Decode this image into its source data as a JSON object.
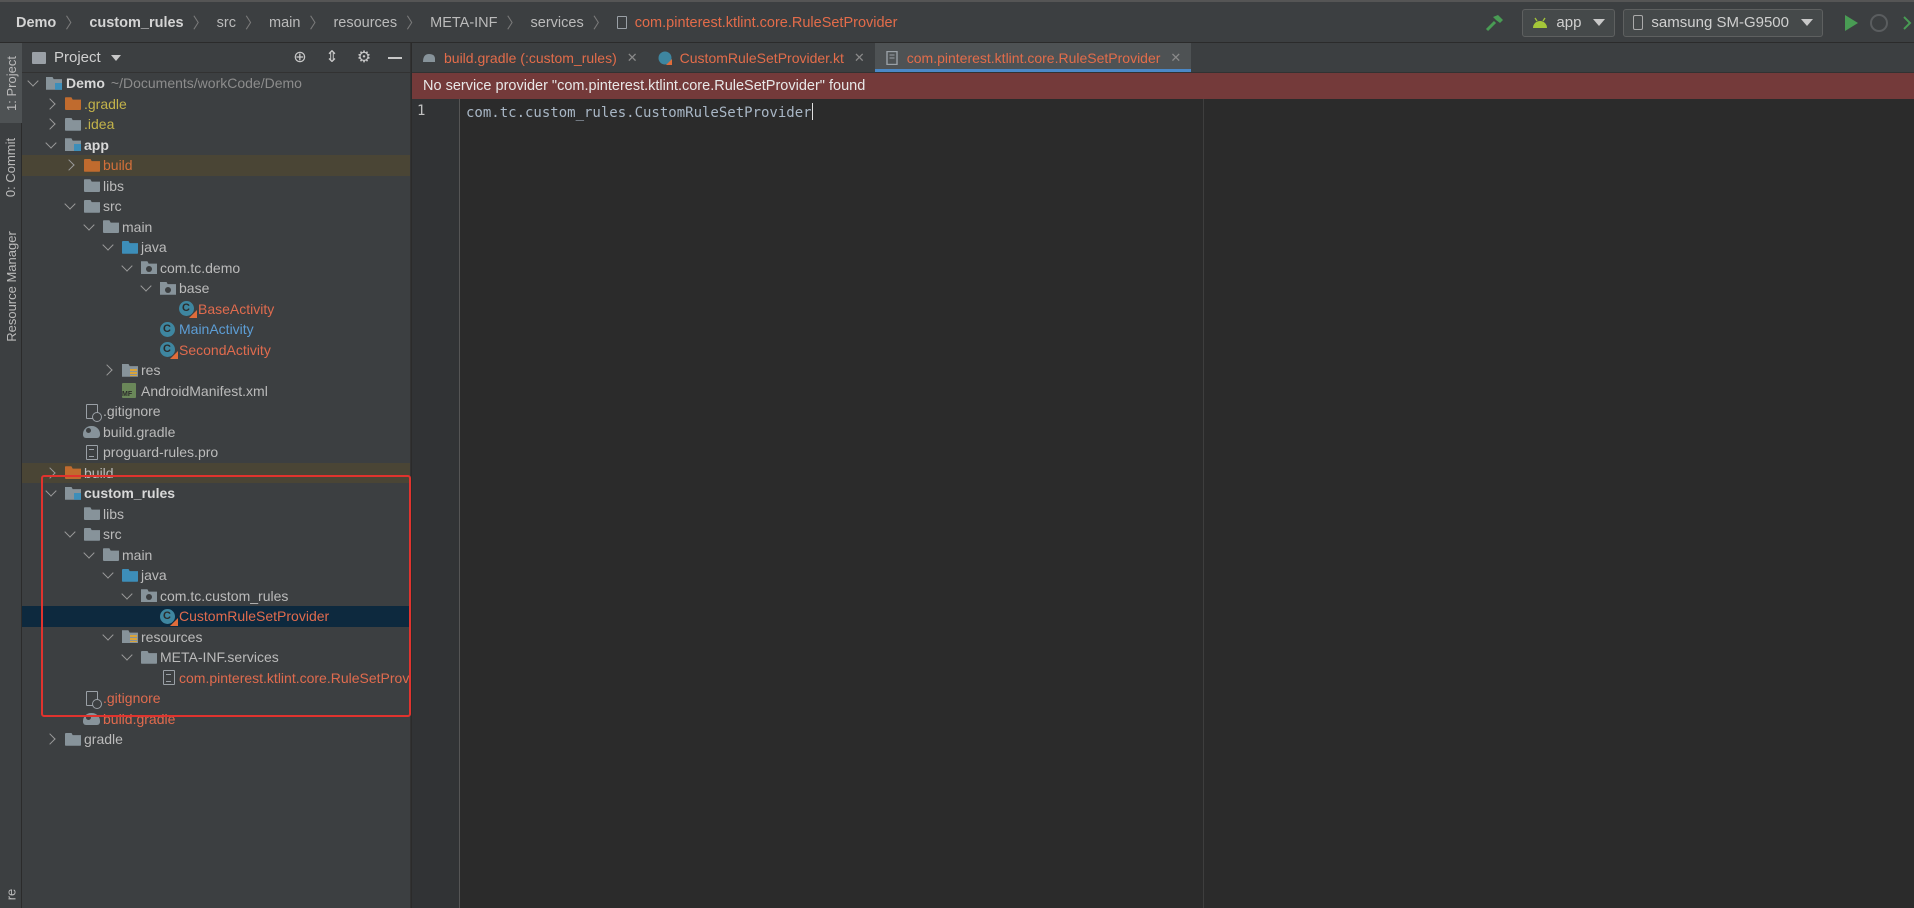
{
  "breadcrumbs": [
    "Demo",
    "custom_rules",
    "src",
    "main",
    "resources",
    "META-INF",
    "services",
    "com.pinterest.ktlint.core.RuleSetProvider"
  ],
  "toolbar": {
    "run_config": "app",
    "device": "samsung SM-G9500"
  },
  "left_strip": {
    "tabs": [
      "1: Project",
      "0: Commit",
      "Resource Manager",
      "re"
    ]
  },
  "project_panel": {
    "title": "Project",
    "tree": [
      {
        "label": "Demo",
        "path": "~/Documents/workCode/Demo"
      },
      {
        "label": ".gradle"
      },
      {
        "label": ".idea"
      },
      {
        "label": "app"
      },
      {
        "label": "build"
      },
      {
        "label": "libs"
      },
      {
        "label": "src"
      },
      {
        "label": "main"
      },
      {
        "label": "java"
      },
      {
        "label": "com.tc.demo"
      },
      {
        "label": "base"
      },
      {
        "label": "BaseActivity"
      },
      {
        "label": "MainActivity"
      },
      {
        "label": "SecondActivity"
      },
      {
        "label": "res"
      },
      {
        "label": "AndroidManifest.xml"
      },
      {
        "label": ".gitignore"
      },
      {
        "label": "build.gradle"
      },
      {
        "label": "proguard-rules.pro"
      },
      {
        "label": "build"
      },
      {
        "label": "custom_rules"
      },
      {
        "label": "libs"
      },
      {
        "label": "src"
      },
      {
        "label": "main"
      },
      {
        "label": "java"
      },
      {
        "label": "com.tc.custom_rules"
      },
      {
        "label": "CustomRuleSetProvider"
      },
      {
        "label": "resources"
      },
      {
        "label": "META-INF.services"
      },
      {
        "label": "com.pinterest.ktlint.core.RuleSetProvider"
      },
      {
        "label": ".gitignore"
      },
      {
        "label": "build.gradle"
      },
      {
        "label": "gradle"
      }
    ]
  },
  "editor": {
    "tabs": [
      {
        "label": "build.gradle (:custom_rules)"
      },
      {
        "label": "CustomRuleSetProvider.kt"
      },
      {
        "label": "com.pinterest.ktlint.core.RuleSetProvider"
      }
    ],
    "banner": "No service provider \"com.pinterest.ktlint.core.RuleSetProvider\" found",
    "line_number": "1",
    "code": "com.tc.custom_rules.CustomRuleSetProvider"
  },
  "colors": {
    "accent_orange": "#e36c4a",
    "banner_bg": "#743a3a",
    "highlight_box": "#e0332e",
    "selection": "#0d293e"
  }
}
